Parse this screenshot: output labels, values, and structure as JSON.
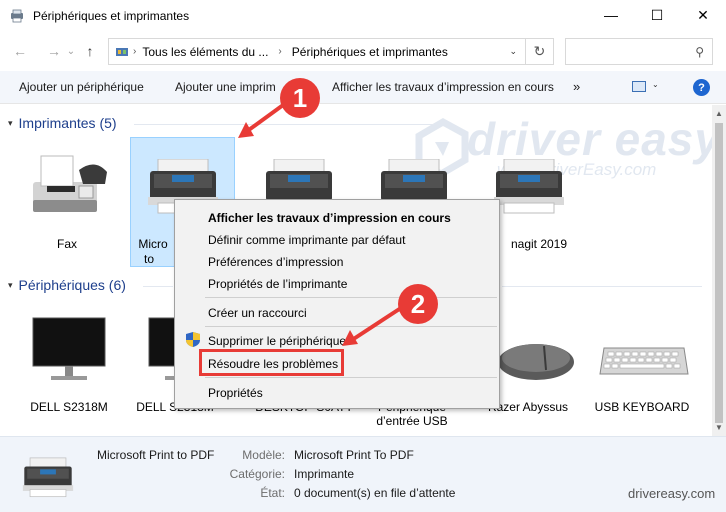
{
  "window": {
    "title": "Périphériques et imprimantes",
    "controls": {
      "minimize": "—",
      "maximize": "☐",
      "close": "✕"
    }
  },
  "navigation": {
    "back": "←",
    "forward": "→",
    "recent": "⌄",
    "up": "↑",
    "breadcrumbs": [
      "Tous les éléments du ...",
      "Périphériques et imprimantes"
    ],
    "separator": "›",
    "dropdown": "⌄",
    "refresh": "↻",
    "search_placeholder": "",
    "search_icon": "⚲"
  },
  "toolbar": {
    "add_device": "Ajouter un périphérique",
    "add_printer": "Ajouter une imprim",
    "see_print_jobs": "Afficher les travaux d’impression en cours",
    "more": "»",
    "help": "?"
  },
  "groups": {
    "printers": {
      "title": "Imprimantes (5)",
      "items": [
        {
          "label": "Fax"
        },
        {
          "label": "Micro",
          "label2": "to"
        },
        {
          "label": ""
        },
        {
          "label": ""
        },
        {
          "label": "nagit 2019"
        }
      ]
    },
    "devices": {
      "title": "Périphériques (6)",
      "items": [
        {
          "label": "DELL S2318M"
        },
        {
          "label": "DELL S2318M"
        },
        {
          "label": "DESKTOP-S0ATT"
        },
        {
          "label": "Périphérique",
          "label2": "d’entrée USB"
        },
        {
          "label": "Razer Abyssus"
        },
        {
          "label": "USB KEYBOARD"
        }
      ]
    }
  },
  "context_menu": {
    "items": [
      "Afficher les travaux d’impression en cours",
      "Définir comme imprimante par défaut",
      "Préférences d’impression",
      "Propriétés de l’imprimante",
      "Créer un raccourci",
      "Supprimer le périphérique",
      "Résoudre les problèmes",
      "Propriétés"
    ]
  },
  "annotations": {
    "step1": "1",
    "step2": "2",
    "accent": "#e83b36"
  },
  "watermark": {
    "brand": "driver easy",
    "url": "www.DriverEasy.com"
  },
  "details": {
    "name": "Microsoft Print to PDF",
    "model_key": "Modèle:",
    "model_val": "Microsoft Print To PDF",
    "category_key": "Catégorie:",
    "category_val": "Imprimante",
    "state_key": "État:",
    "state_val": "0 document(s) en file d’attente"
  },
  "footer_watermark": "drivereasy.com",
  "icons": {
    "app": "devices-printers-icon",
    "printer": "printer-icon",
    "fax": "fax-icon",
    "monitor": "monitor-icon",
    "mouse": "mouse-icon",
    "keyboard": "keyboard-icon",
    "shield": "uac-shield-icon"
  }
}
